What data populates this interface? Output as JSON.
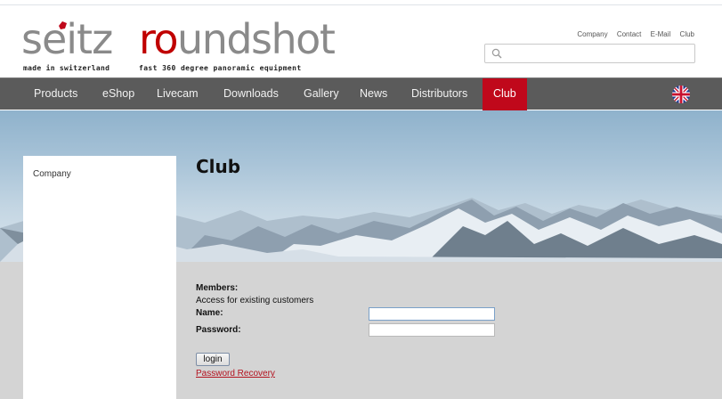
{
  "header": {
    "seitz_logo": "seitz",
    "seitz_tagline": "made in switzerland",
    "roundshot_logo_red": "ro",
    "roundshot_logo_rest": "undshot",
    "roundshot_tagline": "fast 360 degree panoramic equipment",
    "top_links": [
      "Company",
      "Contact",
      "E-Mail",
      "Club"
    ],
    "search": {
      "placeholder": "",
      "icon": "search-icon"
    }
  },
  "nav": {
    "items": [
      "Products",
      "eShop",
      "Livecam",
      "Downloads",
      "Gallery",
      "News",
      "Distributors",
      "Club"
    ],
    "active": "Club",
    "active_color": "#c0081b",
    "language_icon": "uk-flag-icon"
  },
  "sidebar": {
    "items": [
      "Company"
    ]
  },
  "main": {
    "title": "Club",
    "members_label": "Members:",
    "access_text": "Access for existing customers",
    "name_label": "Name:",
    "name_value": "",
    "password_label": "Password:",
    "password_value": "",
    "login_button": "login",
    "recovery_link": "Password Recovery"
  },
  "colors": {
    "nav_bg": "#5b5b5b",
    "accent": "#c0081b",
    "content_bg": "#d4d4d4"
  }
}
